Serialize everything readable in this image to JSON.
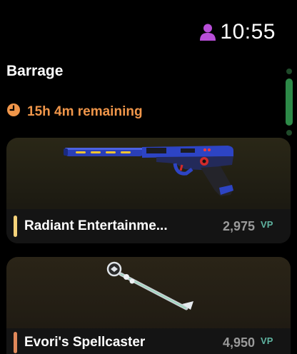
{
  "status": {
    "time": "10:55"
  },
  "header": {
    "title": "Barrage"
  },
  "timer": {
    "text": "15h 4m remaining"
  },
  "colors": {
    "accent_orange": "#f0964a",
    "user_icon": "#b84ed8",
    "vp": "#5fb3a0",
    "scroll": "#2d8a48"
  },
  "items": [
    {
      "name": "Radiant Entertainme...",
      "price": "2,975",
      "currency": "VP",
      "tier_color": "#f5d27a",
      "icon": "pistol-skin-image"
    },
    {
      "name": "Evori's Spellcaster",
      "price": "4,950",
      "currency": "VP",
      "tier_color": "#e0885a",
      "icon": "melee-staff-image"
    }
  ]
}
